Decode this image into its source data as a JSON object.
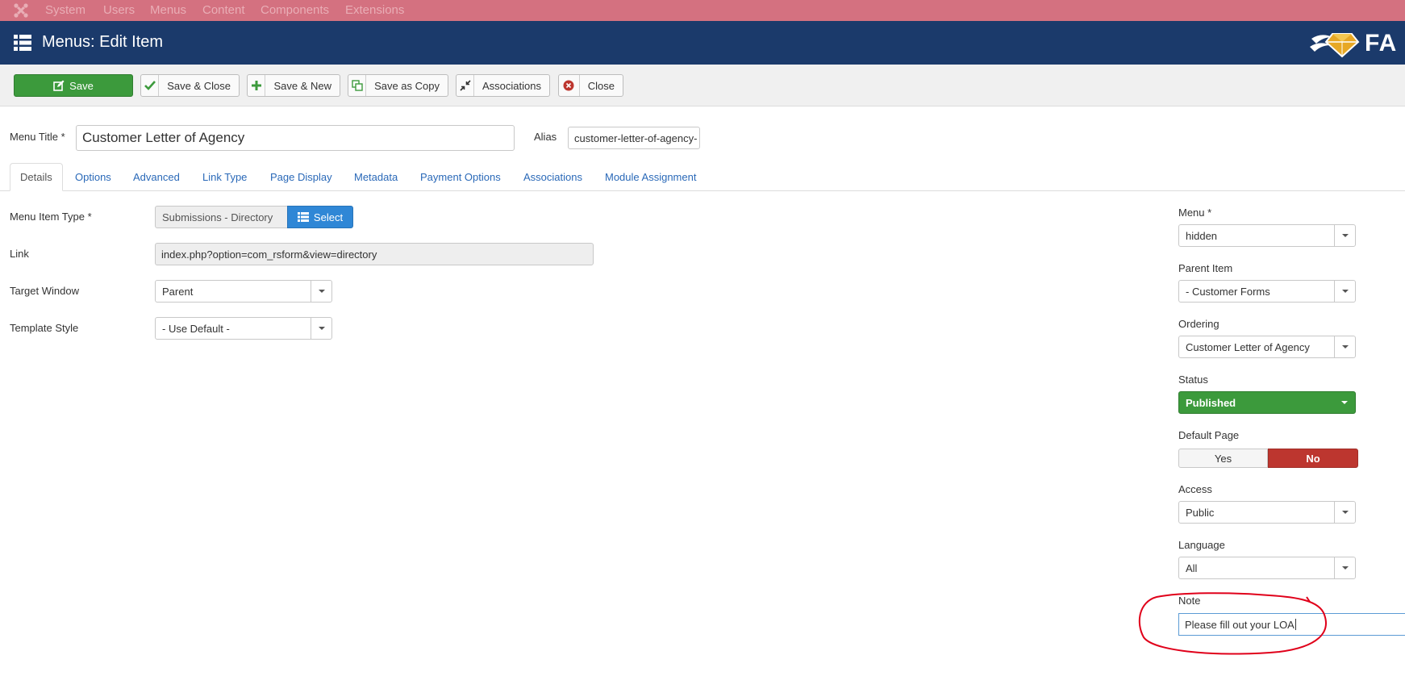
{
  "topbar": {
    "items": [
      "System",
      "Users",
      "Menus",
      "Content",
      "Components",
      "Extensions"
    ]
  },
  "header": {
    "title": "Menus: Edit Item",
    "brand_text": "FA"
  },
  "toolbar": {
    "save": "Save",
    "save_close": "Save & Close",
    "save_new": "Save & New",
    "save_copy": "Save as Copy",
    "associations": "Associations",
    "close": "Close"
  },
  "form": {
    "menu_title_label": "Menu Title *",
    "menu_title_value": "Customer Letter of Agency",
    "alias_label": "Alias",
    "alias_value": "customer-letter-of-agency-"
  },
  "tabs": [
    "Details",
    "Options",
    "Advanced",
    "Link Type",
    "Page Display",
    "Metadata",
    "Payment Options",
    "Associations",
    "Module Assignment"
  ],
  "details": {
    "menu_item_type_label": "Menu Item Type *",
    "menu_item_type_value": "Submissions - Directory",
    "select_button": "Select",
    "link_label": "Link",
    "link_value": "index.php?option=com_rsform&view=directory",
    "target_window_label": "Target Window",
    "target_window_value": "Parent",
    "template_style_label": "Template Style",
    "template_style_value": "- Use Default -"
  },
  "sidebar": {
    "menu_label": "Menu *",
    "menu_value": "hidden",
    "parent_label": "Parent Item",
    "parent_value": "- Customer Forms",
    "ordering_label": "Ordering",
    "ordering_value": "Customer Letter of Agency",
    "status_label": "Status",
    "status_value": "Published",
    "default_page_label": "Default Page",
    "default_yes": "Yes",
    "default_no": "No",
    "access_label": "Access",
    "access_value": "Public",
    "language_label": "Language",
    "language_value": "All",
    "note_label": "Note",
    "note_value": "Please fill out your LOA"
  },
  "colors": {
    "topbar": "#d47180",
    "header": "#1b3a6b",
    "save_green": "#3c9a3c",
    "select_blue": "#2f87d6",
    "no_red": "#bd362f",
    "annotation_red": "#e0001a"
  }
}
